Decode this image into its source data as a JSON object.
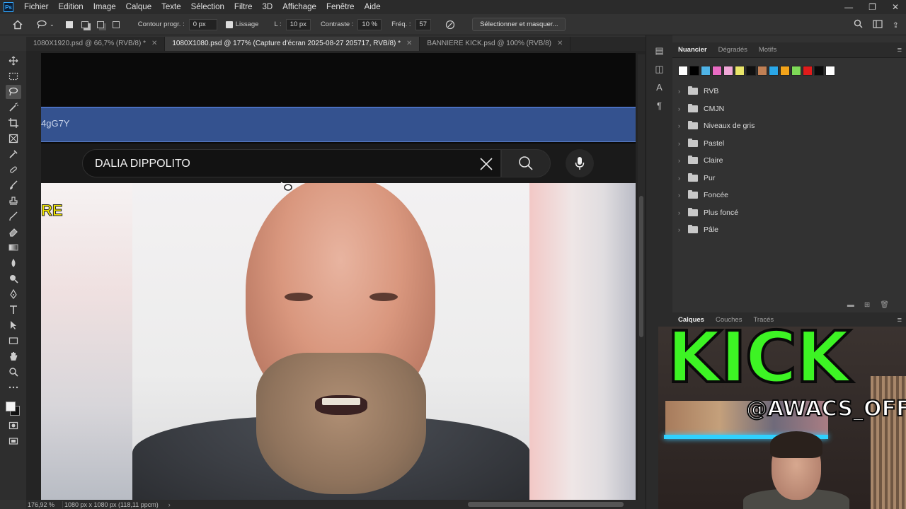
{
  "app": {
    "logo_text": "Ps"
  },
  "menubar": {
    "items": [
      "Fichier",
      "Edition",
      "Image",
      "Calque",
      "Texte",
      "Sélection",
      "Filtre",
      "3D",
      "Affichage",
      "Fenêtre",
      "Aide"
    ],
    "window_controls": [
      "—",
      "❐",
      "✕"
    ]
  },
  "options_bar": {
    "contour_label": "Contour progr. :",
    "contour_value": "0 px",
    "lissage_label": "Lissage",
    "l_label": "L :",
    "l_value": "10 px",
    "contraste_label": "Contraste :",
    "contraste_value": "10 %",
    "freq_label": "Fréq. :",
    "freq_value": "57",
    "select_mask_button": "Sélectionner et masquer..."
  },
  "tabs": [
    {
      "label": "1080X1920.psd @ 66,7% (RVB/8) *",
      "active": false
    },
    {
      "label": "1080X1080.psd @ 177% (Capture d'écran 2025-08-27 205717, RVB/8) *",
      "active": true
    },
    {
      "label": "BANNIERE KICK.psd @ 100% (RVB/8)",
      "active": false
    }
  ],
  "canvas": {
    "url_fragment": "4gG7Y",
    "search_query": "DALIA DIPPOLITO",
    "overlay_text": "RE"
  },
  "status": {
    "zoom": "176,92 %",
    "doc_info": "1080 px x 1080 px (118,11 ppcm)"
  },
  "swatch_panel": {
    "tabs": [
      "Nuancier",
      "Dégradés",
      "Motifs"
    ],
    "colors": [
      "#ffffff",
      "#000000",
      "#4fb3e6",
      "#e96bc3",
      "#f0a8d8",
      "#e9e56a",
      "#101010",
      "#c08055",
      "#2aa7e8",
      "#f3a41a",
      "#7ed957",
      "#e01b1b",
      "#0a0a0a",
      "#ffffff"
    ],
    "folders": [
      "RVB",
      "CMJN",
      "Niveaux de gris",
      "Pastel",
      "Claire",
      "Pur",
      "Foncée",
      "Plus foncé",
      "Pâle"
    ]
  },
  "layers_panel": {
    "tabs": [
      "Calques",
      "Couches",
      "Tracés"
    ]
  },
  "overlay": {
    "kick_text": "KICK",
    "handle": "@AWACS_OFF",
    "kick_color": "#3df424"
  }
}
